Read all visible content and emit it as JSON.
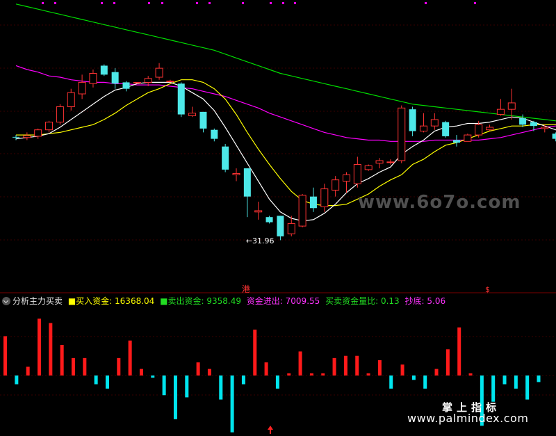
{
  "chart_data": [
    {
      "type": "candlestick",
      "title": "",
      "price_range": [
        28.5,
        50.5
      ],
      "grid": true,
      "annotations": {
        "low_label": "←31.96",
        "low_value": 31.96,
        "marker_a": "港",
        "marker_b": "$"
      },
      "colors": {
        "up": "#ff3333",
        "down": "#4de8e8",
        "ma_white": "#ffffff",
        "ma_yellow": "#ffff00",
        "ma_magenta": "#ff00ff",
        "ma_green": "#00dd00"
      },
      "candles": [
        [
          40.05,
          40.2,
          39.8,
          40.0
        ],
        [
          40.0,
          40.4,
          39.8,
          40.15
        ],
        [
          40.1,
          40.7,
          39.9,
          40.6
        ],
        [
          40.6,
          41.3,
          40.4,
          41.2
        ],
        [
          41.2,
          42.6,
          41.0,
          42.4
        ],
        [
          42.4,
          43.8,
          42.1,
          43.5
        ],
        [
          43.4,
          44.9,
          43.0,
          44.3
        ],
        [
          44.2,
          45.3,
          43.9,
          45.0
        ],
        [
          45.6,
          45.7,
          44.8,
          44.9
        ],
        [
          45.1,
          45.4,
          43.8,
          44.2
        ],
        [
          44.3,
          44.4,
          43.6,
          43.8
        ],
        [
          44.3,
          44.3,
          44.2,
          44.3
        ],
        [
          44.3,
          44.8,
          44.0,
          44.6
        ],
        [
          44.7,
          45.8,
          44.5,
          45.4
        ],
        [
          44.4,
          44.5,
          44.3,
          44.4
        ],
        [
          44.2,
          44.3,
          41.6,
          41.8
        ],
        [
          41.7,
          42.4,
          41.6,
          41.9
        ],
        [
          42.0,
          42.0,
          40.4,
          40.7
        ],
        [
          40.6,
          40.7,
          39.7,
          39.9
        ],
        [
          39.3,
          39.5,
          37.3,
          37.5
        ],
        [
          37.1,
          37.6,
          36.6,
          37.2
        ],
        [
          37.6,
          37.6,
          33.8,
          35.4
        ],
        [
          34.2,
          35.0,
          33.6,
          34.3
        ],
        [
          33.8,
          33.9,
          33.3,
          33.4
        ],
        [
          33.9,
          33.9,
          32.0,
          32.3
        ],
        [
          32.5,
          33.9,
          32.3,
          33.3
        ],
        [
          33.1,
          35.6,
          33.0,
          35.5
        ],
        [
          35.4,
          36.1,
          34.2,
          34.5
        ],
        [
          34.6,
          36.4,
          34.2,
          36.0
        ],
        [
          35.9,
          37.0,
          35.4,
          36.7
        ],
        [
          36.6,
          37.3,
          35.7,
          37.1
        ],
        [
          36.4,
          38.5,
          36.1,
          37.9
        ],
        [
          37.5,
          37.9,
          37.4,
          37.8
        ],
        [
          38.0,
          38.4,
          37.6,
          38.2
        ],
        [
          38.1,
          38.3,
          37.9,
          38.1
        ],
        [
          38.2,
          42.5,
          38.0,
          42.3
        ],
        [
          42.2,
          42.4,
          40.1,
          40.5
        ],
        [
          40.5,
          41.9,
          40.4,
          40.9
        ],
        [
          40.9,
          41.9,
          40.6,
          41.4
        ],
        [
          41.2,
          41.3,
          40.0,
          40.1
        ],
        [
          39.8,
          40.2,
          39.3,
          39.6
        ],
        [
          39.7,
          40.3,
          39.7,
          40.2
        ],
        [
          40.2,
          41.3,
          40.0,
          41.0
        ],
        [
          40.6,
          41.0,
          40.5,
          40.8
        ],
        [
          41.8,
          43.0,
          41.7,
          42.2
        ],
        [
          42.2,
          43.8,
          41.4,
          42.7
        ],
        [
          41.5,
          41.8,
          40.8,
          41.0
        ],
        [
          41.2,
          41.3,
          40.5,
          40.9
        ],
        [
          40.7,
          41.0,
          40.4,
          40.8
        ],
        [
          40.3,
          40.4,
          39.7,
          39.9
        ],
        [
          40.4,
          41.0,
          40.2,
          40.7
        ]
      ],
      "ma_white": [
        39.9,
        40.0,
        40.1,
        40.3,
        40.8,
        41.4,
        42.0,
        42.6,
        43.2,
        43.7,
        43.9,
        44.2,
        44.3,
        44.3,
        44.3,
        44.0,
        43.5,
        43.0,
        42.1,
        40.8,
        39.4,
        38.0,
        36.6,
        35.2,
        34.2,
        33.7,
        33.5,
        33.6,
        34.1,
        34.8,
        35.7,
        36.4,
        36.8,
        37.3,
        37.7,
        38.7,
        39.3,
        39.8,
        40.5,
        40.8,
        40.9,
        41.1,
        41.1,
        41.2,
        41.4,
        41.6,
        41.5,
        41.2,
        40.9,
        40.6,
        40.4
      ],
      "ma_yellow": [
        40.2,
        40.2,
        40.2,
        40.3,
        40.4,
        40.6,
        40.8,
        41.0,
        41.4,
        41.9,
        42.5,
        43.0,
        43.5,
        43.8,
        44.2,
        44.5,
        44.5,
        44.3,
        43.8,
        43.0,
        41.8,
        40.4,
        39.1,
        37.9,
        36.8,
        35.8,
        35.1,
        34.8,
        34.7,
        34.7,
        34.8,
        35.2,
        35.6,
        36.2,
        36.7,
        37.1,
        37.9,
        38.3,
        38.9,
        39.4,
        39.6,
        39.9,
        40.2,
        40.5,
        40.7,
        40.9,
        40.9,
        41.0,
        41.0,
        41.0,
        40.8
      ],
      "ma_magenta": [
        45.6,
        45.3,
        45.1,
        44.8,
        44.7,
        44.5,
        44.4,
        44.3,
        44.3,
        44.2,
        44.2,
        44.1,
        44.1,
        44.1,
        44.0,
        43.9,
        43.8,
        43.6,
        43.4,
        43.2,
        42.9,
        42.6,
        42.3,
        41.9,
        41.6,
        41.3,
        41.0,
        40.7,
        40.4,
        40.2,
        40.0,
        39.9,
        39.8,
        39.8,
        39.7,
        39.7,
        39.7,
        39.7,
        39.8,
        39.8,
        39.8,
        39.8,
        39.8,
        39.9,
        40.0,
        40.2,
        40.4,
        40.6,
        40.8,
        40.9,
        41.1
      ],
      "ma_green": [
        50.4,
        50.2,
        50.0,
        49.8,
        49.6,
        49.4,
        49.2,
        49.0,
        48.8,
        48.6,
        48.4,
        48.2,
        48.0,
        47.8,
        47.6,
        47.4,
        47.2,
        47.0,
        46.8,
        46.5,
        46.2,
        45.9,
        45.6,
        45.3,
        45.0,
        44.8,
        44.6,
        44.4,
        44.2,
        44.0,
        43.8,
        43.6,
        43.4,
        43.2,
        43.0,
        42.8,
        42.6,
        42.5,
        42.4,
        42.3,
        42.2,
        42.1,
        42.0,
        41.9,
        41.8,
        41.7,
        41.6,
        41.5,
        41.4,
        41.3,
        41.2
      ]
    },
    {
      "type": "bar",
      "title": "分析主力买卖",
      "legend": [
        {
          "name": "买入资金",
          "value": "16368.04",
          "color": "#ffff00"
        },
        {
          "name": "卖出资金",
          "value": "9358.49",
          "color": "#00dd00"
        },
        {
          "name": "资金进出",
          "value": "7009.55",
          "color": "#ff00ff"
        },
        {
          "name": "买卖资金量比",
          "value": "0.13",
          "color": "#00dd00"
        },
        {
          "name": "抄底",
          "value": "5.06",
          "color": "#ff00ff"
        }
      ],
      "ylim": [
        -1.3,
        1.4
      ],
      "colors": {
        "positive": "#ff1a1a",
        "negative": "#00e5ee"
      },
      "values": [
        0.9,
        -0.2,
        0.2,
        1.3,
        1.2,
        0.7,
        0.4,
        0.4,
        -0.2,
        -0.3,
        0.4,
        0.8,
        0.15,
        -0.05,
        -0.45,
        -1.0,
        -0.5,
        0.3,
        0.15,
        -0.55,
        -1.3,
        -0.2,
        1.05,
        0.3,
        -0.3,
        0.05,
        0.55,
        0.05,
        0.05,
        0.4,
        0.45,
        0.45,
        0.05,
        0.35,
        -0.3,
        0.25,
        -0.1,
        -0.3,
        0.15,
        0.6,
        1.1,
        0.05,
        -1.15,
        -0.6,
        -0.2,
        -0.3,
        -0.55,
        -0.15
      ]
    }
  ],
  "header": {
    "indicator_name": "分析主力买卖",
    "buy_label": "■买入资金: 16368.04",
    "sell_label": "■卖出资金: 9358.49",
    "flow_label": "资金进出: 7009.55",
    "ratio_label": "买卖资金量比: 0.13",
    "bottom_label": "抄底: 5.06"
  },
  "watermarks": {
    "url1": "www.6o7o.com",
    "brand_cn": "掌上指标",
    "url2": "www.palmindex.com"
  }
}
